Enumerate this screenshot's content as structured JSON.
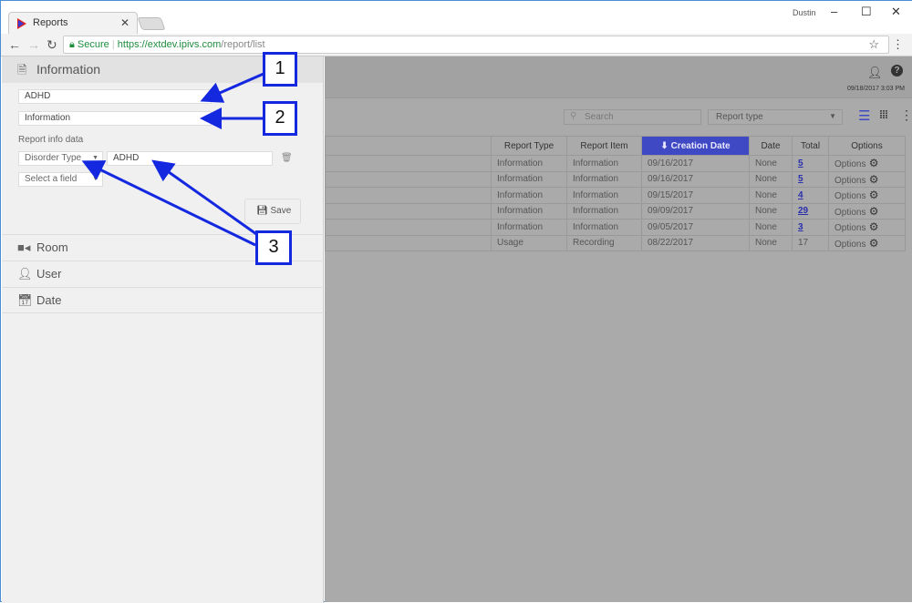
{
  "browser": {
    "tab_title": "Reports",
    "user": "Dustin",
    "secure": "Secure",
    "url_host": "https://extdev.ipivs.com",
    "url_path": "/report/list"
  },
  "sidebar": {
    "section": "Information",
    "name_value": "ADHD",
    "type_value": "Information",
    "report_info_label": "Report info data",
    "field_select": "Disorder Type",
    "field_value": "ADHD",
    "add_field_select": "Select a field",
    "save_label": "Save",
    "items": [
      {
        "label": "Room",
        "icon": "video-camera-icon"
      },
      {
        "label": "User",
        "icon": "user-icon"
      },
      {
        "label": "Date",
        "icon": "calendar-icon"
      }
    ]
  },
  "header": {
    "datetime": "09/18/2017 3:03 PM"
  },
  "toolbar": {
    "search_placeholder": "Search",
    "report_type": "Report type"
  },
  "table": {
    "columns": [
      "",
      "Report Type",
      "Report Item",
      "Creation Date",
      "Date",
      "Total",
      "Options"
    ],
    "rows": [
      [
        "",
        "Information",
        "Information",
        "09/16/2017",
        "None",
        "5",
        "Options"
      ],
      [
        "",
        "Information",
        "Information",
        "09/16/2017",
        "None",
        "5",
        "Options"
      ],
      [
        "",
        "Information",
        "Information",
        "09/15/2017",
        "None",
        "4",
        "Options"
      ],
      [
        "",
        "Information",
        "Information",
        "09/09/2017",
        "None",
        "29",
        "Options"
      ],
      [
        "",
        "Information",
        "Information",
        "09/05/2017",
        "None",
        "3",
        "Options"
      ],
      [
        "",
        "Usage",
        "Recording",
        "08/22/2017",
        "None",
        "17",
        "Options"
      ]
    ]
  },
  "annotations": [
    "1",
    "2",
    "3"
  ],
  "colors": {
    "accent": "#3f49c4",
    "annotation": "#1428e0"
  }
}
